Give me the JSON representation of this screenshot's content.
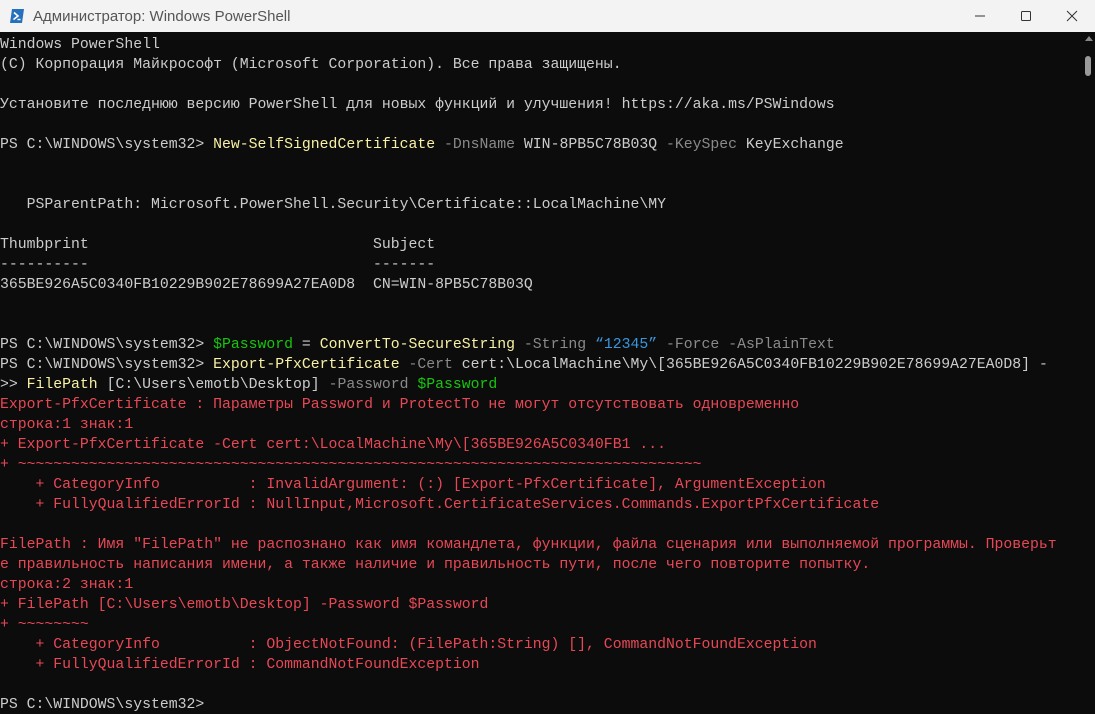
{
  "window": {
    "title": "Администратор: Windows PowerShell",
    "icon": "powershell-icon",
    "controls": [
      "minimize-icon",
      "maximize-icon",
      "close-icon"
    ]
  },
  "console": {
    "lines": [
      [
        {
          "t": "Windows PowerShell",
          "c": "w"
        }
      ],
      [
        {
          "t": "(C) Корпорация Майкрософт (Microsoft Corporation). Все права защищены.",
          "c": "w"
        }
      ],
      [],
      [
        {
          "t": "Установите последнюю версию PowerShell для новых функций и улучшения! https://aka.ms/PSWindows",
          "c": "w"
        }
      ],
      [],
      [
        {
          "t": "PS C:\\WINDOWS\\system32> ",
          "c": "w"
        },
        {
          "t": "New-SelfSignedCertificate",
          "c": "y"
        },
        {
          "t": " -DnsName",
          "c": "g"
        },
        {
          "t": " WIN-8PB5C78B03Q",
          "c": "w"
        },
        {
          "t": " -KeySpec",
          "c": "g"
        },
        {
          "t": " KeyExchange",
          "c": "w"
        }
      ],
      [],
      [],
      [
        {
          "t": "   PSParentPath: Microsoft.PowerShell.Security\\Certificate::LocalMachine\\MY",
          "c": "w"
        }
      ],
      [],
      [
        {
          "t": "Thumbprint                                Subject",
          "c": "w"
        }
      ],
      [
        {
          "t": "----------                                -------",
          "c": "w"
        }
      ],
      [
        {
          "t": "365BE926A5C0340FB10229B902E78699A27EA0D8  CN=WIN-8PB5C78B03Q",
          "c": "w"
        }
      ],
      [],
      [],
      [
        {
          "t": "PS C:\\WINDOWS\\system32> ",
          "c": "w"
        },
        {
          "t": "$Password",
          "c": "gr"
        },
        {
          "t": " = ",
          "c": "w"
        },
        {
          "t": "ConvertTo-SecureString",
          "c": "y"
        },
        {
          "t": " -String",
          "c": "g"
        },
        {
          "t": " “12345”",
          "c": "bl"
        },
        {
          "t": " -Force",
          "c": "g"
        },
        {
          "t": " -AsPlainText",
          "c": "g"
        }
      ],
      [
        {
          "t": "PS C:\\WINDOWS\\system32> ",
          "c": "w"
        },
        {
          "t": "Export-PfxCertificate",
          "c": "y"
        },
        {
          "t": " -Cert",
          "c": "g"
        },
        {
          "t": " cert:\\LocalMachine\\My\\[365BE926A5C0340FB10229B902E78699A27EA0D8] -",
          "c": "w"
        }
      ],
      [
        {
          "t": ">> ",
          "c": "w"
        },
        {
          "t": "FilePath",
          "c": "y"
        },
        {
          "t": " [C:\\Users\\emotb\\Desktop]",
          "c": "w"
        },
        {
          "t": " -Password",
          "c": "g"
        },
        {
          "t": " $Password",
          "c": "gr"
        }
      ],
      [
        {
          "t": "Export-PfxCertificate : Параметры Password и ProtectTo не могут отсутствовать одновременно",
          "c": "r"
        }
      ],
      [
        {
          "t": "строка:1 знак:1",
          "c": "r"
        }
      ],
      [
        {
          "t": "+ Export-PfxCertificate -Cert cert:\\LocalMachine\\My\\[365BE926A5C0340FB1 ...",
          "c": "r"
        }
      ],
      [
        {
          "t": "+ ~~~~~~~~~~~~~~~~~~~~~~~~~~~~~~~~~~~~~~~~~~~~~~~~~~~~~~~~~~~~~~~~~~~~~~~~~~~~~",
          "c": "r"
        }
      ],
      [
        {
          "t": "    + CategoryInfo          : InvalidArgument: (:) [Export-PfxCertificate], ArgumentException",
          "c": "r"
        }
      ],
      [
        {
          "t": "    + FullyQualifiedErrorId : NullInput,Microsoft.CertificateServices.Commands.ExportPfxCertificate",
          "c": "r"
        }
      ],
      [],
      [
        {
          "t": "FilePath : Имя \"FilePath\" не распознано как имя командлета, функции, файла сценария или выполняемой программы. Проверьт",
          "c": "r"
        }
      ],
      [
        {
          "t": "е правильность написания имени, а также наличие и правильность пути, после чего повторите попытку.",
          "c": "r"
        }
      ],
      [
        {
          "t": "строка:2 знак:1",
          "c": "r"
        }
      ],
      [
        {
          "t": "+ FilePath [C:\\Users\\emotb\\Desktop] -Password $Password",
          "c": "r"
        }
      ],
      [
        {
          "t": "+ ~~~~~~~~",
          "c": "r"
        }
      ],
      [
        {
          "t": "    + CategoryInfo          : ObjectNotFound: (FilePath:String) [], CommandNotFoundException",
          "c": "r"
        }
      ],
      [
        {
          "t": "    + FullyQualifiedErrorId : CommandNotFoundException",
          "c": "r"
        }
      ],
      [],
      [
        {
          "t": "PS C:\\WINDOWS\\system32>",
          "c": "w"
        }
      ]
    ]
  }
}
